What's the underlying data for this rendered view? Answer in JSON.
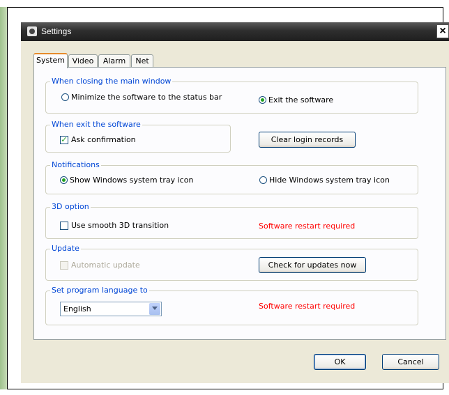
{
  "window": {
    "title": "Settings",
    "close_label": "×"
  },
  "tabs": [
    {
      "label": "System",
      "active": true
    },
    {
      "label": "Video",
      "active": false
    },
    {
      "label": "Alarm",
      "active": false
    },
    {
      "label": "Net",
      "active": false
    }
  ],
  "groups": {
    "closing": {
      "label": "When closing the main window",
      "options": [
        {
          "label": "Minimize the software to the status bar",
          "selected": false
        },
        {
          "label": "Exit the software",
          "selected": true
        }
      ]
    },
    "exit": {
      "label": "When exit the software",
      "ask_confirmation": {
        "label": "Ask confirmation",
        "checked": true
      },
      "clear_button": "Clear login records"
    },
    "notifications": {
      "label": "Notifications",
      "options": [
        {
          "label": "Show Windows system tray icon",
          "selected": true
        },
        {
          "label": "Hide Windows system tray icon",
          "selected": false
        }
      ]
    },
    "option3d": {
      "label": "3D option",
      "smooth": {
        "label": "Use smooth 3D transition",
        "checked": false
      },
      "warning": "Software restart required"
    },
    "update": {
      "label": "Update",
      "auto": {
        "label": "Automatic update",
        "checked": false,
        "disabled": true
      },
      "check_button": "Check for updates now"
    },
    "language": {
      "label": "Set program language to",
      "selected": "English",
      "warning": "Software restart required"
    }
  },
  "footer": {
    "ok": "OK",
    "cancel": "Cancel"
  },
  "colors": {
    "group_label": "#0046d5",
    "warning": "#ff0000",
    "radio_dot": "#21a121"
  }
}
